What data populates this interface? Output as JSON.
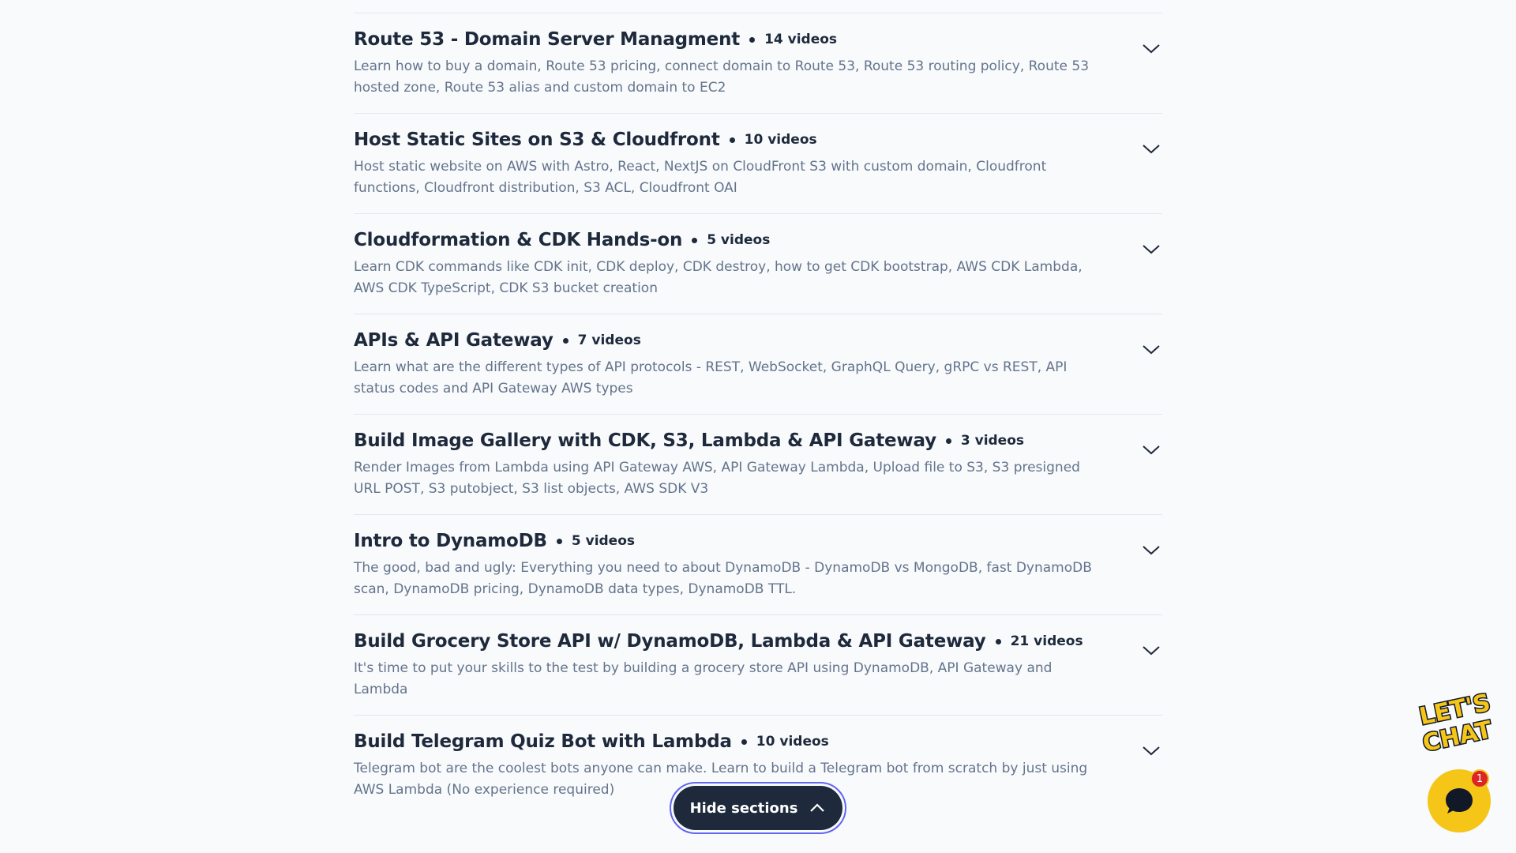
{
  "sections": [
    {
      "title": "Route 53 - Domain Server Managment",
      "count": "14 videos",
      "description": "Learn how to buy a domain, Route 53 pricing, connect domain to Route 53, Route 53 routing policy, Route 53 hosted zone, Route 53 alias and custom domain to EC2"
    },
    {
      "title": "Host Static Sites on S3 & Cloudfront",
      "count": "10 videos",
      "description": "Host static website on AWS with Astro, React, NextJS on CloudFront S3 with custom domain, Cloudfront functions, Cloudfront distribution, S3 ACL, Cloudfront OAI"
    },
    {
      "title": "Cloudformation & CDK Hands-on",
      "count": "5 videos",
      "description": "Learn CDK commands like CDK init, CDK deploy, CDK destroy, how to get CDK bootstrap, AWS CDK Lambda, AWS CDK TypeScript, CDK S3 bucket creation"
    },
    {
      "title": "APIs & API Gateway",
      "count": "7 videos",
      "description": "Learn what are the different types of API protocols - REST, WebSocket, GraphQL Query, gRPC vs REST, API status codes and API Gateway AWS types"
    },
    {
      "title": "Build Image Gallery with CDK, S3, Lambda & API Gateway",
      "count": "3 videos",
      "description": "Render Images from Lambda using API Gateway AWS, API Gateway Lambda, Upload file to S3, S3 presigned URL POST, S3 putobject, S3 list objects, AWS SDK V3"
    },
    {
      "title": "Intro to DynamoDB",
      "count": "5 videos",
      "description": "The good, bad and ugly: Everything you need to about DynamoDB - DynamoDB vs MongoDB, fast DynamoDB scan, DynamoDB pricing, DynamoDB data types, DynamoDB TTL."
    },
    {
      "title": "Build Grocery Store API w/ DynamoDB, Lambda & API Gateway",
      "count": "21 videos",
      "description": "It's time to put your skills to the test by building a grocery store API using DynamoDB, API Gateway and Lambda"
    },
    {
      "title": "Build Telegram Quiz Bot with Lambda",
      "count": "10 videos",
      "description": "Telegram bot are the coolest bots anyone can make. Learn to build a Telegram bot from scratch by just using AWS Lambda (No experience required)"
    }
  ],
  "hide_button": {
    "label": "Hide sections",
    "icon": "chevron-up-icon"
  },
  "chat": {
    "sticker_text": "LET'S CHAT",
    "badge_count": "1",
    "icon": "chat-bubble-icon",
    "color": "#f5c518"
  },
  "colors": {
    "background": "#f8fafc",
    "title": "#1e293b",
    "description": "#64748b",
    "button": "#1e293b",
    "button_ring": "#6366f1",
    "badge": "#dc2626"
  }
}
